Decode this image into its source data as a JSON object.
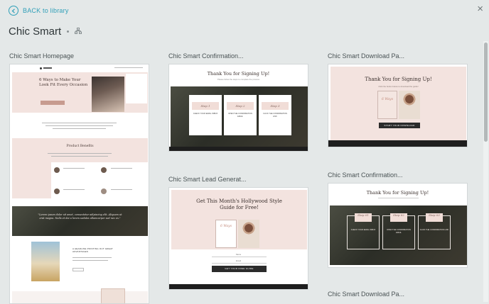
{
  "header": {
    "back_label": "BACK to library",
    "title": "Chic Smart",
    "close_glyph": "×"
  },
  "templates": [
    {
      "label": "Chic Smart Homepage"
    },
    {
      "label": "Chic Smart Confirmation..."
    },
    {
      "label": "Chic Smart Download Pa..."
    },
    {
      "label": "Chic Smart Lead Generat..."
    },
    {
      "label": "Chic Smart Confirmation..."
    },
    {
      "label": "Chic Smart Download Pa..."
    }
  ],
  "previews": {
    "home": {
      "hero_title": "6 Ways to Make Your Look Fit Every Occasion",
      "section_title": "Product Benefits",
      "quote": "\"Lorem ipsum dolor sit amet, consectetur adipiscing elit. Aliquam ut erat magna. Nulla et dui a lorem sodales ullamcorper sed nec ex.\"",
      "feature_heading": "A HEADLINE POINTING OUT GREAT ADVANTAGES"
    },
    "confirm": {
      "title": "Thank You for Signing Up!",
      "subtitle": "Please follow the steps to complete the process",
      "steps": [
        "Step 1",
        "Step 2",
        "Step 3"
      ],
      "step_texts": [
        "CHECK YOUR EMAIL INBOX",
        "OPEN THE CONFIRMATION EMAIL",
        "CLICK THE CONFIRMATION LINK"
      ]
    },
    "download": {
      "title": "Thank You for Signing Up!",
      "subtitle": "Click the button below to download the guide!",
      "book_title": "6 Ways",
      "button": "START YOUR DOWNLOAD"
    },
    "lead": {
      "title": "Get This Month's Hollywood Style Guide for Free!",
      "book_title": "6 Ways",
      "name_label": "Name",
      "email_label": "Email",
      "button": "GET YOUR FREE GUIDE"
    },
    "confirm2": {
      "title": "Thank You for Signing Up!",
      "steps": [
        "Step 01",
        "Step 02",
        "Step 03"
      ],
      "step_texts": [
        "CHECK YOUR EMAIL INBOX",
        "OPEN THE CONFIRMATION EMAIL",
        "CLICK THE CONFIRMATION LINK"
      ]
    }
  },
  "colors": {
    "accent": "#2f9fb8",
    "background": "#e4e8e8",
    "pink": "#f3e3df"
  }
}
